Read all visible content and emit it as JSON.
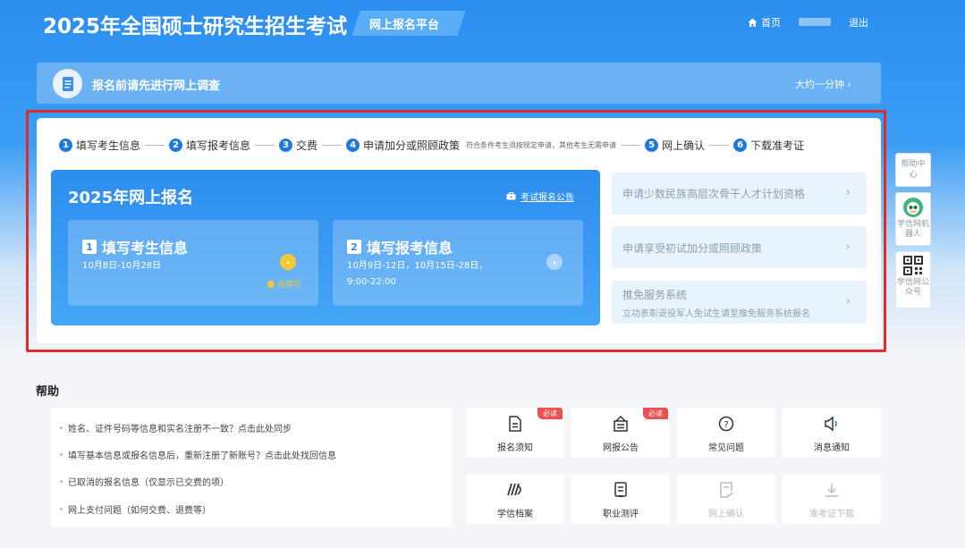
{
  "header": {
    "site_title": "2025年全国硕士研究生招生考试",
    "platform": "网上报名平台",
    "home": "首页",
    "logout": "退出"
  },
  "survey": {
    "text": "报名前请先进行网上调查",
    "time": "大约一分钟 ›"
  },
  "steps": [
    {
      "num": "1",
      "label": "填写考生信息"
    },
    {
      "num": "2",
      "label": "填写报考信息"
    },
    {
      "num": "3",
      "label": "交费"
    },
    {
      "num": "4",
      "label": "申请加分或照顾政策",
      "note": "符合条件考生须按规定申请，其他考生无需申请"
    },
    {
      "num": "5",
      "label": "网上确认"
    },
    {
      "num": "6",
      "label": "下载准考证"
    }
  ],
  "registration": {
    "title": "2025年网上报名",
    "notice": "考试报名公告",
    "card1": {
      "num": "1",
      "title": "填写考生信息",
      "date": "10月8日-10月28日",
      "status": "待填写"
    },
    "card2": {
      "num": "2",
      "title": "填写报考信息",
      "date1": "10月9日-12日，10月15日-28日，",
      "date2": "9:00-22:00"
    }
  },
  "side_options": [
    {
      "label": "申请少数民族高层次骨干人才计划资格"
    },
    {
      "label": "申请享受初试加分或照顾政策"
    },
    {
      "label": "推免服务系统",
      "sub": "立功表彰退役军人免试生请至推免服务系统报名"
    }
  ],
  "float_tools": {
    "help": "帮助中心",
    "robot": "学信网机器人",
    "wechat": "学信网公众号"
  },
  "help": {
    "title": "帮助",
    "items": [
      "姓名、证件号码等信息和实名注册不一致？点击此处同步",
      "填写基本信息或报名信息后，重新注册了新账号？点击此处找回信息",
      "已取消的报名信息（仅显示已交费的项）",
      "网上支付问题（如何交费、退费等）"
    ]
  },
  "tiles": [
    {
      "label": "报名须知",
      "badge": "必读"
    },
    {
      "label": "网报公告",
      "badge": "必读"
    },
    {
      "label": "常见问题"
    },
    {
      "label": "消息通知"
    },
    {
      "label": "学信档案"
    },
    {
      "label": "职业测评"
    },
    {
      "label": "网上确认"
    },
    {
      "label": "准考证下载"
    }
  ]
}
